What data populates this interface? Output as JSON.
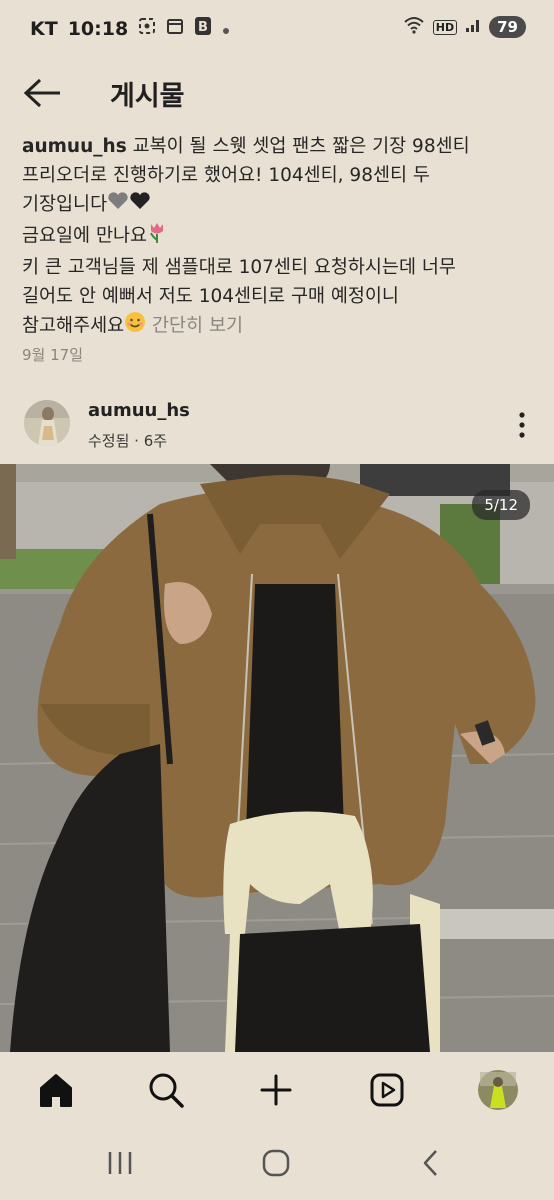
{
  "status_bar": {
    "carrier": "KT",
    "time": "10:18",
    "network": "HD",
    "battery": "79"
  },
  "header": {
    "title": "게시물"
  },
  "caption": {
    "username": "aumuu_hs",
    "line1": " 교복이 될 스웻 셋업 팬츠 짧은 기장 98센티",
    "line2": "프리오더로 진행하기로 했어요! 104센티, 98센티 두",
    "line3": "기장입니다",
    "line4": "금요일에 만나요",
    "line5": "키 큰 고객님들 제 샘플대로 107센티 요청하시는데 너무",
    "line6": "길어도 안 예뻐서 저도 104센티로 구매 예정이니",
    "line7": "참고해주세요",
    "more_label": " 간단히 보기",
    "date": "9월 17일"
  },
  "post": {
    "author": "aumuu_hs",
    "meta": "수정됨 · 6주",
    "photo_counter": "5/12",
    "photo_index": 5,
    "photo_total": 12
  },
  "nav": {
    "items": [
      "home",
      "search",
      "create",
      "reels",
      "profile"
    ]
  },
  "colors": {
    "background": "#e8e1d3",
    "jacket": "#8a6a3e",
    "sweater": "#e9e2c2"
  }
}
